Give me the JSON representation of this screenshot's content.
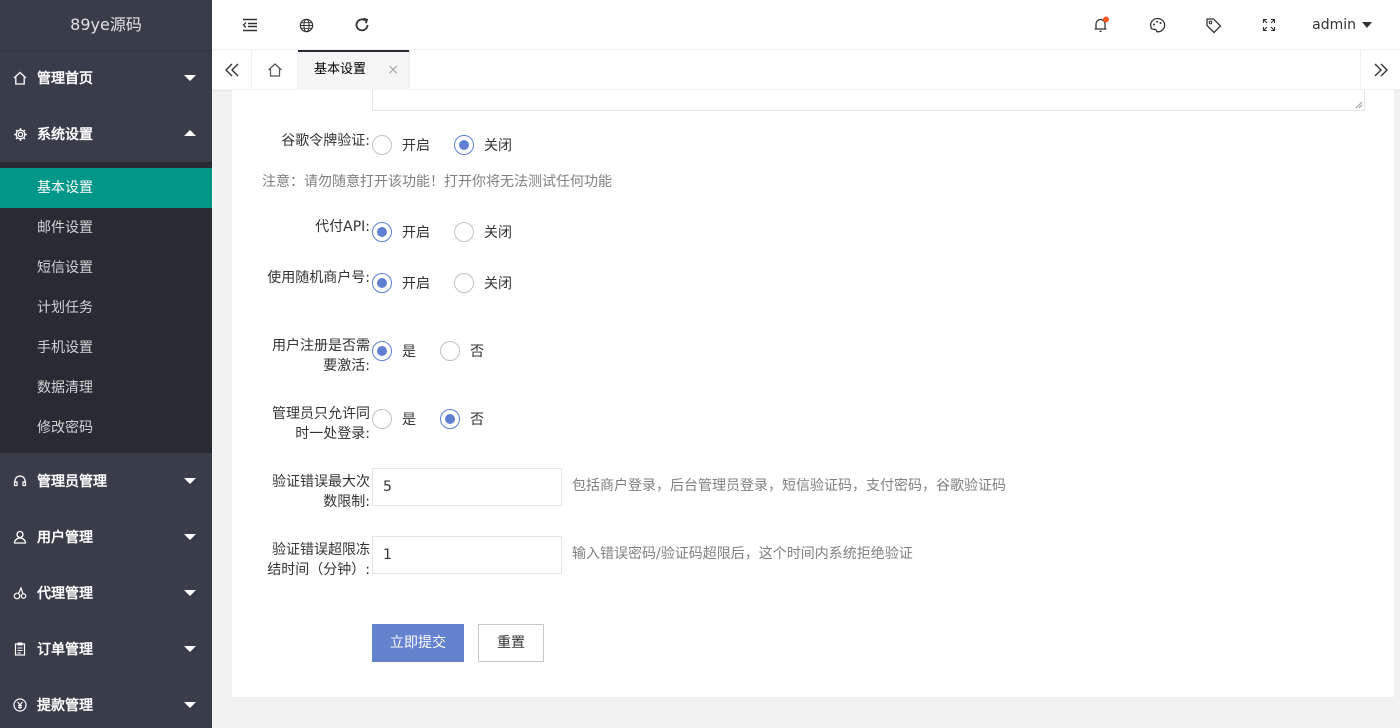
{
  "sidebar": {
    "logo": "89ye源码",
    "groups": [
      {
        "label": "管理首页",
        "icon": "home-icon",
        "expanded": false
      },
      {
        "label": "系统设置",
        "icon": "gear-icon",
        "expanded": true,
        "children": [
          "基本设置",
          "邮件设置",
          "短信设置",
          "计划任务",
          "手机设置",
          "数据清理",
          "修改密码"
        ]
      },
      {
        "label": "管理员管理",
        "icon": "headset-icon",
        "expanded": false
      },
      {
        "label": "用户管理",
        "icon": "user-icon",
        "expanded": false
      },
      {
        "label": "代理管理",
        "icon": "agent-icon",
        "expanded": false
      },
      {
        "label": "订单管理",
        "icon": "order-icon",
        "expanded": false
      },
      {
        "label": "提款管理",
        "icon": "yen-icon",
        "expanded": false
      }
    ],
    "active_child": "基本设置"
  },
  "header": {
    "user": "admin",
    "icons": [
      "menu-fold-icon",
      "globe-icon",
      "refresh-icon",
      "bell-icon",
      "palette-icon",
      "tag-icon",
      "fullscreen-icon"
    ],
    "notification_dot_color": "#ff5722"
  },
  "tabs": {
    "items": [
      {
        "label": "基本设置",
        "close": "×"
      }
    ]
  },
  "form": {
    "google_auth": {
      "label": "谷歌令牌验证:",
      "options": [
        "开启",
        "关闭"
      ],
      "selected": "关闭"
    },
    "note": "注意：请勿随意打开该功能！打开你将无法测试任何功能",
    "payment_api": {
      "label": "代付API:",
      "options": [
        "开启",
        "关闭"
      ],
      "selected": "开启"
    },
    "random_merchant": {
      "label": "使用随机商户号:",
      "options": [
        "开启",
        "关闭"
      ],
      "selected": "开启"
    },
    "register_activate": {
      "label": "用户注册是否需要激活:",
      "options": [
        "是",
        "否"
      ],
      "selected": "是"
    },
    "admin_single_login": {
      "label": "管理员只允许同时一处登录:",
      "options": [
        "是",
        "否"
      ],
      "selected": "否"
    },
    "max_attempts": {
      "label": "验证错误最大次数限制:",
      "value": "5",
      "aux": "包括商户登录，后台管理员登录，短信验证码，支付密码，谷歌验证码"
    },
    "freeze_time": {
      "label": "验证错误超限冻结时间（分钟）:",
      "value": "1",
      "aux": "输入错误密码/验证码超限后，这个时间内系统拒绝验证"
    },
    "submit_label": "立即提交",
    "reset_label": "重置"
  },
  "colors": {
    "sidebar_bg": "#393d49",
    "sidebar_sub_bg": "#282b33",
    "active_item": "#009688",
    "radio_accent": "#5f7fd2",
    "primary_button": "#6482cd"
  }
}
